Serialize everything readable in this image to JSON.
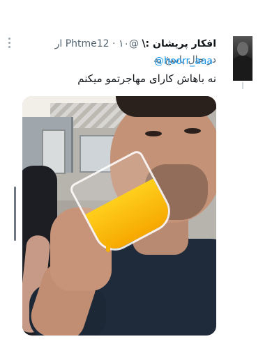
{
  "tweet": {
    "display_name": "افکار پریشان :\\",
    "handle": "@Phtme12",
    "separator": "·",
    "time": "۱۰ ار",
    "reply_prefix": "در حال پاسخ به",
    "reply_to": "@hoorr_aaa",
    "text": "نه باهاش کارای مهاجرتمو میکنم"
  },
  "icons": {
    "more": "more-dots-icon",
    "avatar": "user-avatar"
  }
}
